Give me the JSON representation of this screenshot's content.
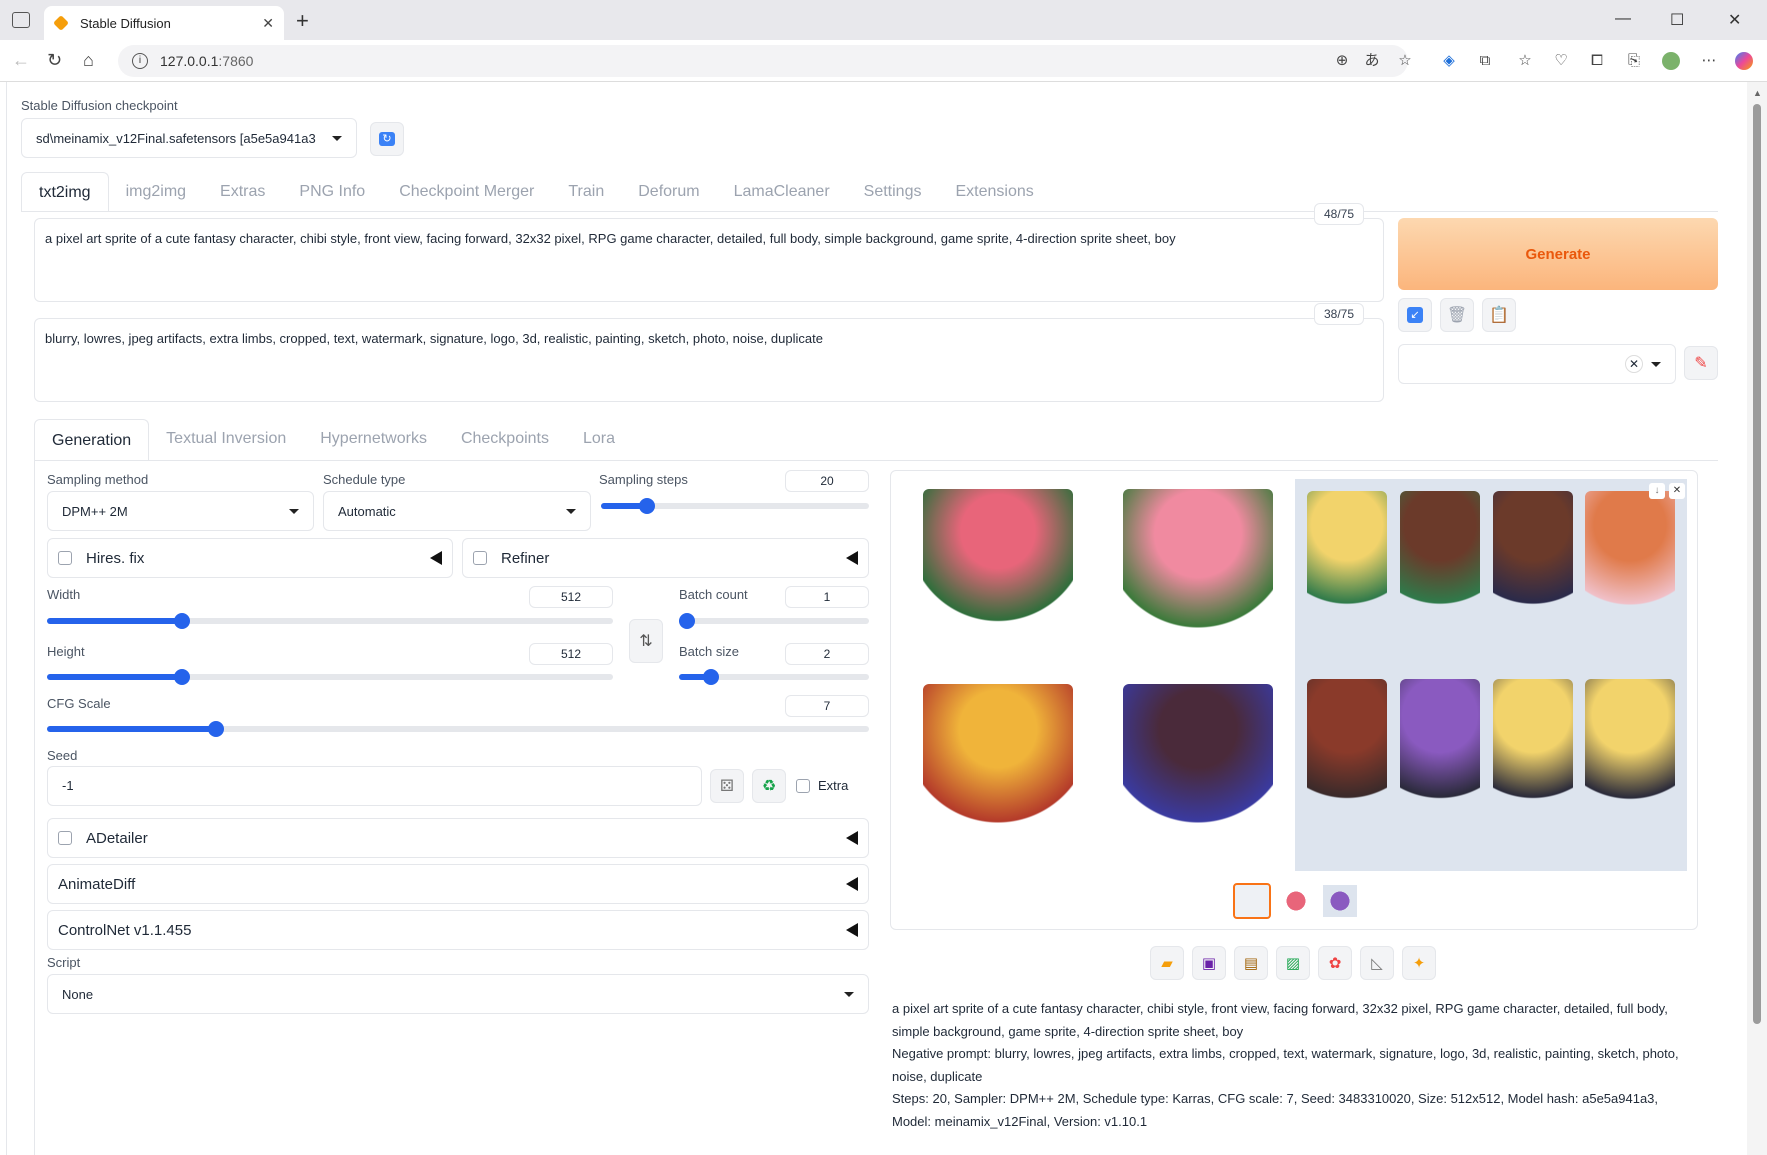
{
  "browser": {
    "tab_title": "Stable Diffusion",
    "url_host": "127.0.0.1",
    "url_port": ":7860"
  },
  "checkpoint": {
    "label": "Stable Diffusion checkpoint",
    "value": "sd\\meinamix_v12Final.safetensors [a5e5a941a3"
  },
  "main_tabs": [
    "txt2img",
    "img2img",
    "Extras",
    "PNG Info",
    "Checkpoint Merger",
    "Train",
    "Deforum",
    "LamaCleaner",
    "Settings",
    "Extensions"
  ],
  "prompt": {
    "positive": "a pixel art sprite of a cute fantasy character, chibi style, front view, facing forward, 32x32 pixel, RPG game character, detailed, full body, simple background, game sprite, 4-direction sprite sheet, boy",
    "positive_count": "48/75",
    "negative": "blurry, lowres, jpeg artifacts, extra limbs, cropped, text, watermark, signature, logo, 3d, realistic, painting, sketch, photo, noise, duplicate",
    "negative_count": "38/75"
  },
  "generate_label": "Generate",
  "sub_tabs": [
    "Generation",
    "Textual Inversion",
    "Hypernetworks",
    "Checkpoints",
    "Lora"
  ],
  "generation": {
    "sampling_method_label": "Sampling method",
    "sampling_method": "DPM++ 2M",
    "schedule_type_label": "Schedule type",
    "schedule_type": "Automatic",
    "sampling_steps_label": "Sampling steps",
    "sampling_steps": "20",
    "hires_label": "Hires. fix",
    "refiner_label": "Refiner",
    "width_label": "Width",
    "width": "512",
    "height_label": "Height",
    "height": "512",
    "batch_count_label": "Batch count",
    "batch_count": "1",
    "batch_size_label": "Batch size",
    "batch_size": "2",
    "cfg_label": "CFG Scale",
    "cfg": "7",
    "seed_label": "Seed",
    "seed": "-1",
    "extra_label": "Extra",
    "adetailer_label": "ADetailer",
    "animatediff_label": "AnimateDiff",
    "controlnet_label": "ControlNet v1.1.455",
    "script_label": "Script",
    "script": "None"
  },
  "sliders": {
    "steps_fraction": 0.15,
    "width_fraction": 0.23,
    "height_fraction": 0.23,
    "batch_count_fraction": 0.0,
    "batch_size_fraction": 0.14,
    "cfg_fraction": 0.2
  },
  "output_info": {
    "line1": "a pixel art sprite of a cute fantasy character, chibi style, front view, facing forward, 32x32 pixel, RPG game character, detailed, full body, simple background, game sprite, 4-direction sprite sheet, boy",
    "line2": "Negative prompt: blurry, lowres, jpeg artifacts, extra limbs, cropped, text, watermark, signature, logo, 3d, realistic, painting, sketch, photo, noise, duplicate",
    "line3": "Steps: 20, Sampler: DPM++ 2M, Schedule type: Karras, CFG scale: 7, Seed: 3483310020, Size: 512x512, Model hash: a5e5a941a3, Model: meinamix_v12Final, Version: v1.10.1"
  },
  "colors": {
    "accent": "#2563eb",
    "generate_text": "#ea580c",
    "selected_thumb": "#f97316"
  }
}
